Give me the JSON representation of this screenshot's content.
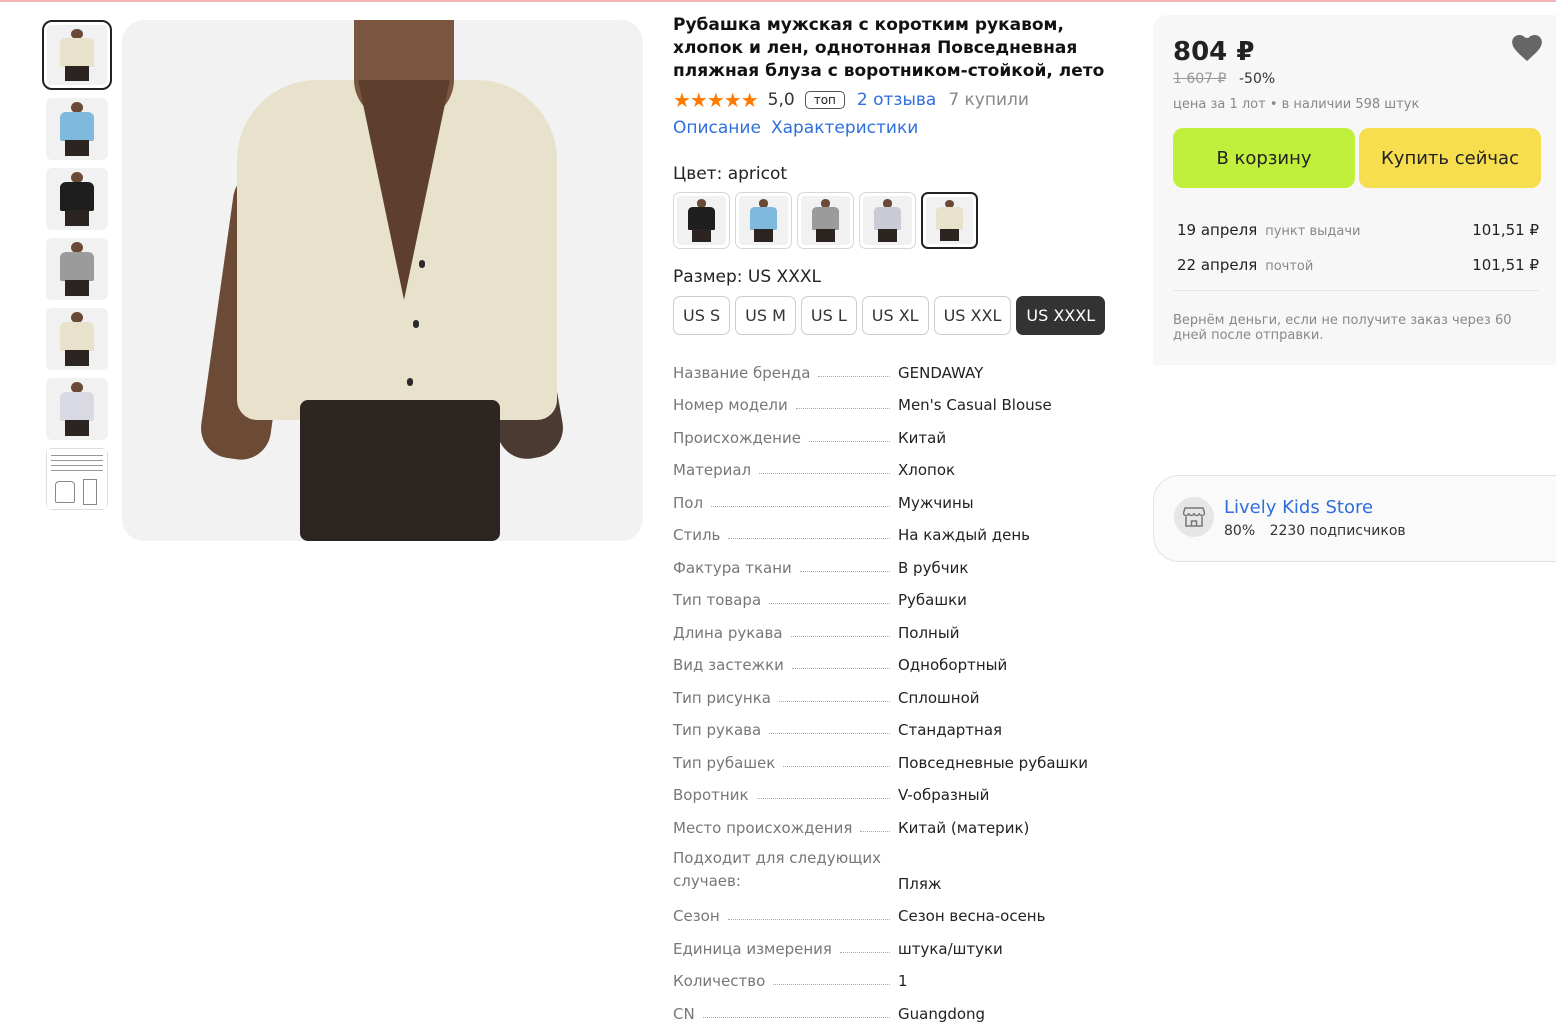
{
  "product": {
    "title": "Рубашка мужская с коротким рукавом, хлопок и лен, однотонная Повседневная пляжная блуза с воротником-стойкой, лето",
    "stars": "★★★★★",
    "rating": "5,0",
    "badge": "топ",
    "reviews": "2 отзыва",
    "bought": "7 купили"
  },
  "links": {
    "description": "Описание",
    "characteristics": "Характеристики"
  },
  "color": {
    "label": "Цвет: apricot",
    "swatches": [
      {
        "name": "black",
        "shirt": "#1e1e1e"
      },
      {
        "name": "blue",
        "shirt": "#7fb9dd"
      },
      {
        "name": "gray",
        "shirt": "#9b9b9b"
      },
      {
        "name": "light-gray",
        "shirt": "#c9cbd6"
      },
      {
        "name": "apricot",
        "shirt": "#e8e2cc",
        "selected": true
      }
    ]
  },
  "size": {
    "label": "Размер: US XXXL",
    "options": [
      "US S",
      "US M",
      "US L",
      "US XL",
      "US XXL",
      "US XXXL"
    ],
    "selected": "US XXXL"
  },
  "thumbnails": [
    {
      "shirt": "#e8e2cc"
    },
    {
      "shirt": "#7fb9dd"
    },
    {
      "shirt": "#1e1e1e"
    },
    {
      "shirt": "#9b9b9b"
    },
    {
      "shirt": "#e8e2cc"
    },
    {
      "shirt": "#d9d9e3"
    },
    {
      "shirt": "size-chart"
    }
  ],
  "specs": [
    {
      "k": "Название бренда",
      "v": "GENDAWAY"
    },
    {
      "k": "Номер модели",
      "v": "Men's Casual Blouse"
    },
    {
      "k": "Происхождение",
      "v": "Китай"
    },
    {
      "k": "Материал",
      "v": "Хлопок"
    },
    {
      "k": "Пол",
      "v": "Мужчины"
    },
    {
      "k": "Стиль",
      "v": "На каждый день"
    },
    {
      "k": "Фактура ткани",
      "v": "В рубчик"
    },
    {
      "k": "Тип товара",
      "v": "Рубашки"
    },
    {
      "k": "Длина рукава",
      "v": "Полный"
    },
    {
      "k": "Вид застежки",
      "v": "Однобортный"
    },
    {
      "k": "Тип рисунка",
      "v": "Сплошной"
    },
    {
      "k": "Тип рукава",
      "v": "Стандартная"
    },
    {
      "k": "Тип рубашек",
      "v": "Повседневные рубашки"
    },
    {
      "k": "Воротник",
      "v": "V-образный"
    },
    {
      "k": "Место происхождения",
      "v": "Китай (материк)"
    },
    {
      "k": "Подходит для следующих случаев:",
      "v": "Пляж",
      "multi": true
    },
    {
      "k": "Сезон",
      "v": "Сезон весна-осень"
    },
    {
      "k": "Единица измерения",
      "v": "штука/штуки"
    },
    {
      "k": "Количество",
      "v": "1"
    },
    {
      "k": "CN",
      "v": "Guangdong"
    }
  ],
  "buybox": {
    "price": "804 ₽",
    "old_price": "1 607 ₽",
    "discount": "-50%",
    "lot_info": "цена за 1 лот • в наличии 598 штук",
    "cart_button": "В корзину",
    "buy_button": "Купить сейчас",
    "delivery": [
      {
        "date": "19 апреля",
        "method": "пункт выдачи",
        "price": "101,51 ₽"
      },
      {
        "date": "22 апреля",
        "method": "почтой",
        "price": "101,51 ₽"
      }
    ],
    "refund": "Вернём деньги, если не получите заказ через 60 дней после отправки.",
    "heart_icon": "heart-icon"
  },
  "store": {
    "name": "Lively Kids Store",
    "rating": "80%",
    "followers": "2230 подписчиков",
    "icon": "store-icon"
  },
  "colors": {
    "accent_link": "#2f6fdb",
    "star": "#ff7a00",
    "cart_btn": "#c0f03c",
    "buy_btn": "#f6de4e"
  }
}
